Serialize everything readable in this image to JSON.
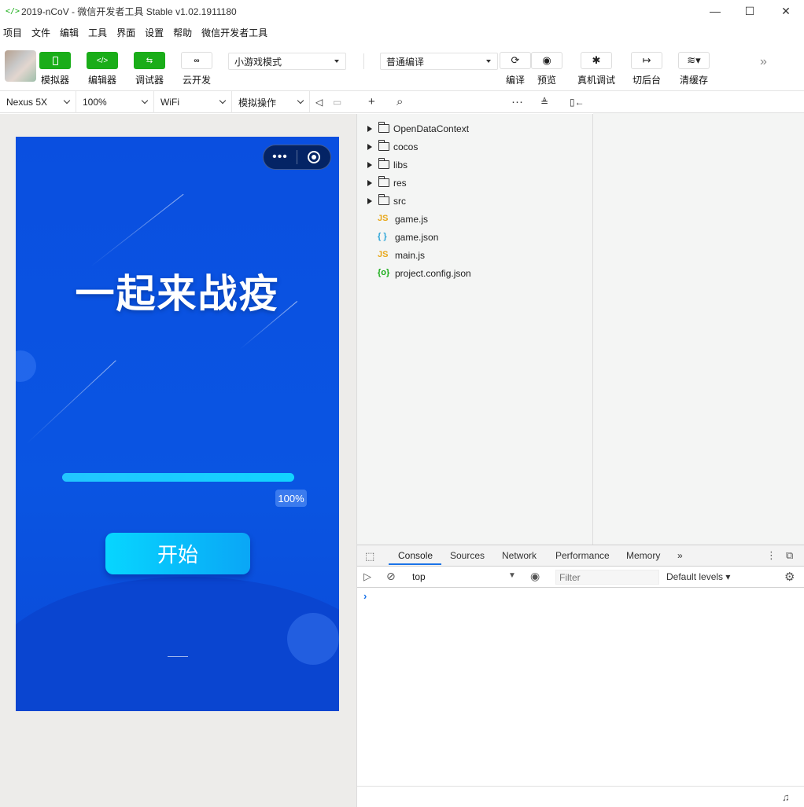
{
  "window": {
    "title": "2019-nCoV - 微信开发者工具 Stable v1.02.1911180",
    "logo_glyph": "</>",
    "minimize": "—",
    "maximize": "☐",
    "close": "✕"
  },
  "menu": [
    "项目",
    "文件",
    "编辑",
    "工具",
    "界面",
    "设置",
    "帮助",
    "微信开发者工具"
  ],
  "toolbar": {
    "simulator": "模拟器",
    "editor": "编辑器",
    "debugger": "调试器",
    "cloud": "云开发",
    "mode_select": "小游戏模式",
    "compile_select": "普通编译",
    "compile": "编译",
    "preview": "预览",
    "remote_debug": "真机调试",
    "background": "切后台",
    "clear_cache": "清缓存",
    "more": "»"
  },
  "simbar": {
    "device": "Nexus 5X",
    "zoom": "100%",
    "network": "WiFi",
    "operations": "模拟操作"
  },
  "game": {
    "title": "一起来战疫",
    "progress_label": "100%",
    "progress_value": 1.0,
    "start_button": "开始",
    "capsule_dots": "•••",
    "bg_color": "#0a52e0"
  },
  "filetree": {
    "folders": [
      "OpenDataContext",
      "cocos",
      "libs",
      "res",
      "src"
    ],
    "files": [
      {
        "name": "game.js",
        "type": "JS",
        "color": "#e8a81b"
      },
      {
        "name": "game.json",
        "type": "{ }",
        "color": "#2aa4d8"
      },
      {
        "name": "main.js",
        "type": "JS",
        "color": "#e8a81b"
      },
      {
        "name": "project.config.json",
        "type": "{o}",
        "color": "#1aad19"
      }
    ]
  },
  "devtools": {
    "tabs": [
      "Console",
      "Sources",
      "Network",
      "Performance",
      "Memory"
    ],
    "more_tabs": "»",
    "context": "top",
    "filter_placeholder": "Filter",
    "levels": "Default levels ▾",
    "prompt": "›"
  }
}
